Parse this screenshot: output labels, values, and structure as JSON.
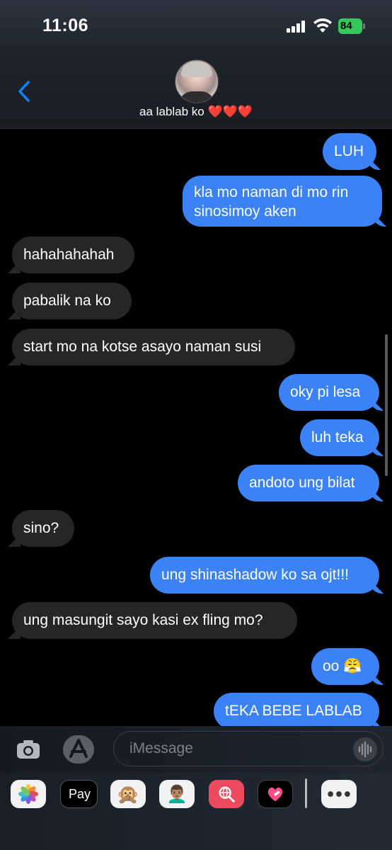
{
  "status_bar": {
    "time": "11:06",
    "battery": "84"
  },
  "header": {
    "contact_name": "aa lablab ko ❤️❤️❤️"
  },
  "messages": [
    {
      "text": "LUH",
      "direction": "sent"
    },
    {
      "text": "kla mo naman di mo rin sinosimoy aken",
      "direction": "sent"
    },
    {
      "text": "hahahahahah",
      "direction": "received"
    },
    {
      "text": "pabalik na ko",
      "direction": "received"
    },
    {
      "text": "start mo na kotse asayo naman susi",
      "direction": "received"
    },
    {
      "text": "oky pi lesa",
      "direction": "sent"
    },
    {
      "text": "luh teka",
      "direction": "sent"
    },
    {
      "text": "andoto ung bilat",
      "direction": "sent"
    },
    {
      "text": "sino?",
      "direction": "received"
    },
    {
      "text": "ung shinashadow ko sa ojt!!!",
      "direction": "sent"
    },
    {
      "text": "ung masungit sayo kasi ex fling mo?",
      "direction": "received"
    },
    {
      "text": "oo 😤",
      "direction": "sent"
    },
    {
      "text": "tEKA BEBE LABLAB",
      "direction": "sent"
    }
  ],
  "input": {
    "placeholder": "iMessage"
  },
  "app_drawer": {
    "apple_pay_label": "Pay",
    "icons": [
      "photos-icon",
      "apple-pay-icon",
      "animoji-icon",
      "memoji-icon",
      "image-search-icon",
      "digital-touch-icon",
      "more-apps-icon"
    ]
  },
  "colors": {
    "sent_bubble": "#3a82f6",
    "received_bubble": "#262628",
    "accent": "#0a84ff"
  }
}
